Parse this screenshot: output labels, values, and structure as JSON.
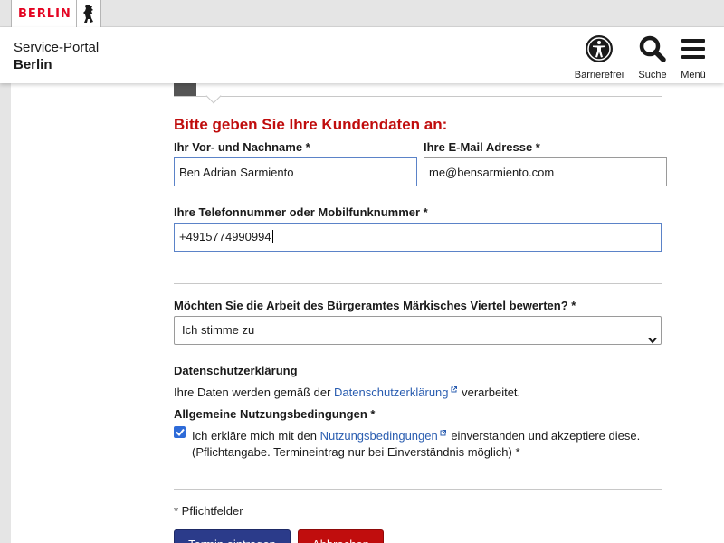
{
  "topbar": {
    "logo_text": "BERLIN"
  },
  "header": {
    "portal_line1": "Service-Portal",
    "portal_line2": "Berlin",
    "accessibility_label": "Barrierefrei",
    "search_label": "Suche",
    "menu_label": "Menü"
  },
  "form": {
    "section_title": "Bitte geben Sie Ihre Kundendaten an:",
    "name_label": "Ihr Vor- und Nachname *",
    "name_value": "Ben Adrian Sarmiento",
    "email_label": "Ihre E-Mail Adresse *",
    "email_value": "me@bensarmiento.com",
    "phone_label": "Ihre Telefonnummer oder Mobilfunknummer *",
    "phone_value": "+4915774990994",
    "rating_label": "Möchten Sie die Arbeit des Bürgeramtes Märkisches Viertel bewerten? *",
    "rating_value": "Ich stimme zu",
    "privacy_heading": "Datenschutzerklärung",
    "privacy_text_before": "Ihre Daten werden gemäß der ",
    "privacy_link": "Datenschutzerklärung",
    "privacy_text_after": " verarbeitet.",
    "terms_heading": "Allgemeine Nutzungsbedingungen *",
    "terms_text_before": "Ich erkläre mich mit den ",
    "terms_link": "Nutzungsbedingungen",
    "terms_text_after": " einverstanden und akzeptiere diese.",
    "terms_line2": "(Pflichtangabe. Termineintrag nur bei Einverständnis möglich) *",
    "terms_checked": true,
    "required_note": "* Pflichtfelder",
    "submit_label": "Termin eintragen",
    "cancel_label": "Abbrechen"
  },
  "colors": {
    "heading_red": "#c00d0d",
    "link_blue": "#2a5db0",
    "primary_button": "#2b3b8a",
    "danger_button": "#c00d0d"
  },
  "icons": {
    "accessibility": "accessibility-icon",
    "search": "search-icon",
    "menu": "hamburger-menu-icon",
    "bear": "berlin-bear-icon",
    "external": "external-link-icon"
  }
}
